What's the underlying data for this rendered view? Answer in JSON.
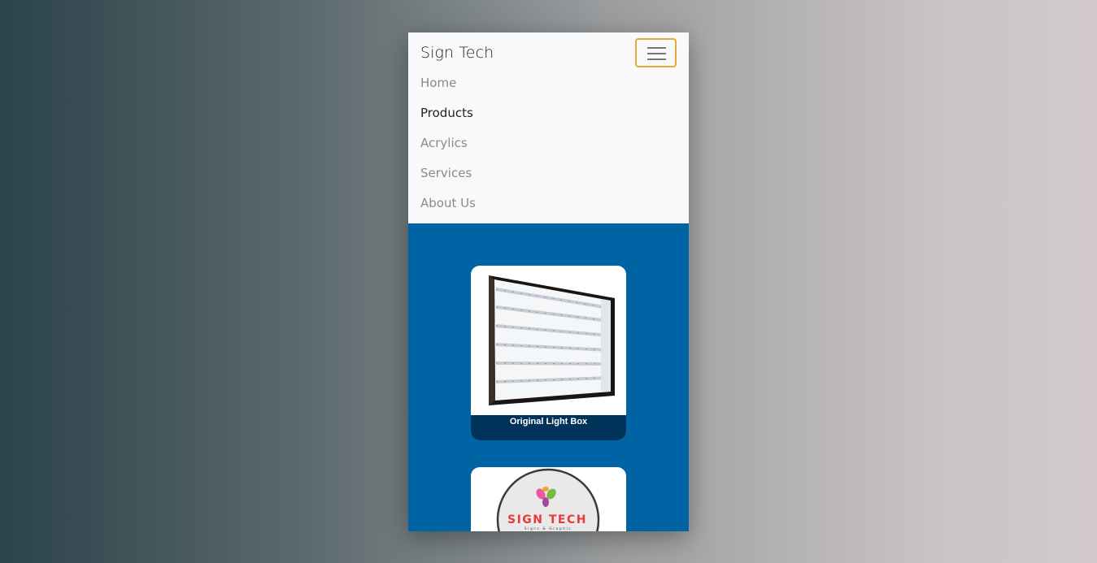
{
  "navbar": {
    "brand": "Sign Tech",
    "toggler_icon": "hamburger-icon",
    "items": [
      {
        "label": "Home",
        "active": false
      },
      {
        "label": "Products",
        "active": true
      },
      {
        "label": "Acrylics",
        "active": false
      },
      {
        "label": "Services",
        "active": false
      },
      {
        "label": "About Us",
        "active": false
      }
    ]
  },
  "products": [
    {
      "caption": "Original Light Box",
      "image": "led-light-box-image"
    },
    {
      "caption": "",
      "image": "sign-tech-logo-image",
      "logo_text": "SIGN TECH",
      "logo_sub": "Signs & Graphic"
    }
  ],
  "colors": {
    "navbar_bg": "#f8f9fa",
    "content_bg": "#0063a3",
    "caption_bg": "#00335a",
    "toggler_border": "#e8a93b",
    "logo_red": "#e83a3a"
  }
}
